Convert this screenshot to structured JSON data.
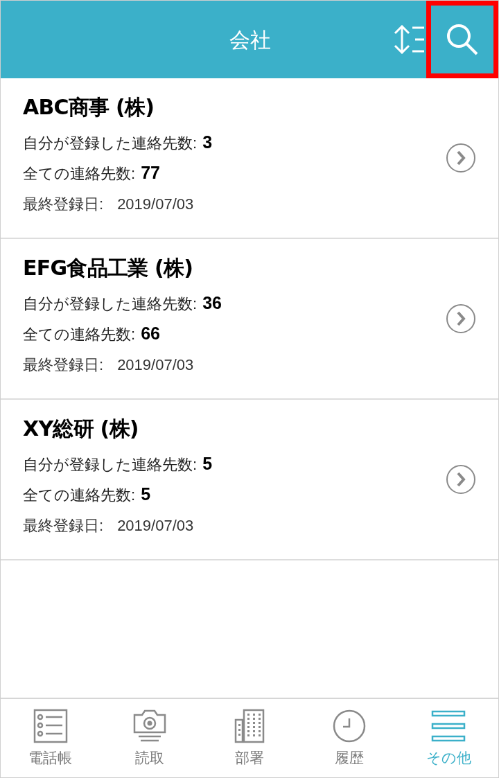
{
  "header": {
    "title": "会社",
    "search": {
      "highlighted": true
    }
  },
  "companies": [
    {
      "name": "ABC商事 (株)",
      "own_label": "自分が登録した連絡先数:",
      "own_count": "3",
      "total_label": "全ての連絡先数:",
      "total_count": "77",
      "date_label": "最終登録日:",
      "date": "2019/07/03"
    },
    {
      "name": "EFG食品工業 (株)",
      "own_label": "自分が登録した連絡先数:",
      "own_count": "36",
      "total_label": "全ての連絡先数:",
      "total_count": "66",
      "date_label": "最終登録日:",
      "date": "2019/07/03"
    },
    {
      "name": "XY総研 (株)",
      "own_label": "自分が登録した連絡先数:",
      "own_count": "5",
      "total_label": "全ての連絡先数:",
      "total_count": "5",
      "date_label": "最終登録日:",
      "date": "2019/07/03"
    }
  ],
  "tabs": [
    {
      "kind": "list",
      "label": "電話帳",
      "selected": false
    },
    {
      "kind": "camera",
      "label": "読取",
      "selected": false
    },
    {
      "kind": "building",
      "label": "部署",
      "selected": false
    },
    {
      "kind": "clock",
      "label": "履歴",
      "selected": false
    },
    {
      "kind": "menu",
      "label": "その他",
      "selected": true
    }
  ]
}
